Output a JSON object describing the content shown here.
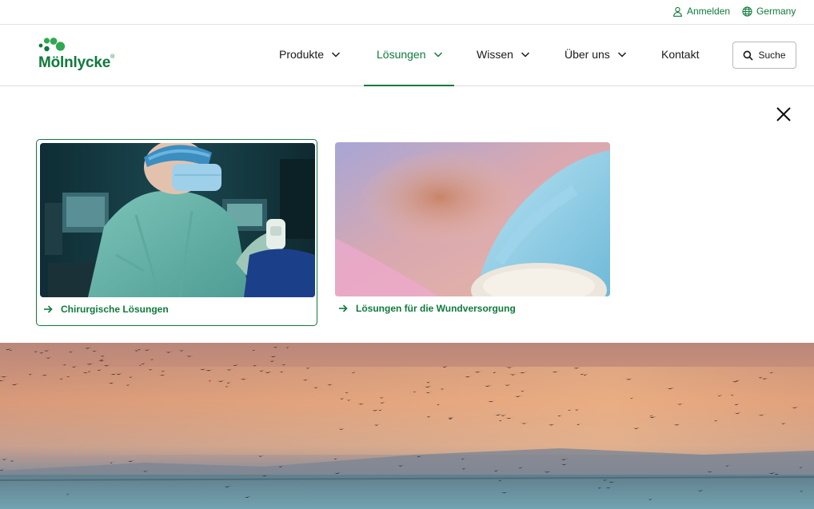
{
  "utility": {
    "login_label": "Anmelden",
    "country_label": "Germany"
  },
  "brand": {
    "name": "Mölnlycke",
    "registered": "®",
    "color": "#0f7a3c"
  },
  "nav": {
    "items": [
      {
        "label": "Produkte",
        "dropdown": true,
        "active": false
      },
      {
        "label": "Lösungen",
        "dropdown": true,
        "active": true
      },
      {
        "label": "Wissen",
        "dropdown": true,
        "active": false
      },
      {
        "label": "Über uns",
        "dropdown": true,
        "active": false
      },
      {
        "label": "Kontakt",
        "dropdown": false,
        "active": false
      }
    ]
  },
  "search": {
    "label": "Suche",
    "icon": "search-icon"
  },
  "menu": {
    "close_icon": "close-icon",
    "cards": [
      {
        "label": "Chirurgische Lösungen",
        "selected": true,
        "image": "surgeon-photo"
      },
      {
        "label": "Lösungen für die Wundversorgung",
        "selected": false,
        "image": "gloved-hand-wound-care-photo"
      }
    ]
  },
  "hero": {
    "image": "birds-over-sunset-sea-photo"
  }
}
